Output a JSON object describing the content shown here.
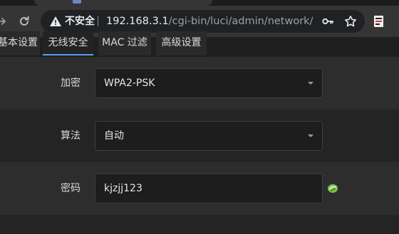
{
  "browser": {
    "security_label": "不安全",
    "url_host": "192.168.3.1",
    "url_path": "/cgi-bin/luci/admin/network/wi...",
    "icons": [
      "forward-icon",
      "reload-icon",
      "warning-icon",
      "key-icon",
      "star-icon",
      "extension-icon"
    ]
  },
  "tabs": [
    {
      "label": "基本设置",
      "active": false
    },
    {
      "label": "无线安全",
      "active": true
    },
    {
      "label": "MAC 过滤",
      "active": false
    },
    {
      "label": "高级设置",
      "active": false
    }
  ],
  "form": {
    "encryption": {
      "label": "加密",
      "value": "WPA2-PSK"
    },
    "algorithm": {
      "label": "算法",
      "value": "自动"
    },
    "password": {
      "label": "密码",
      "value": "kjzjj123"
    }
  },
  "colors": {
    "accent": "#5a9cf0",
    "background": "#1f1f1f",
    "reveal_icon": "#7cc24a"
  }
}
